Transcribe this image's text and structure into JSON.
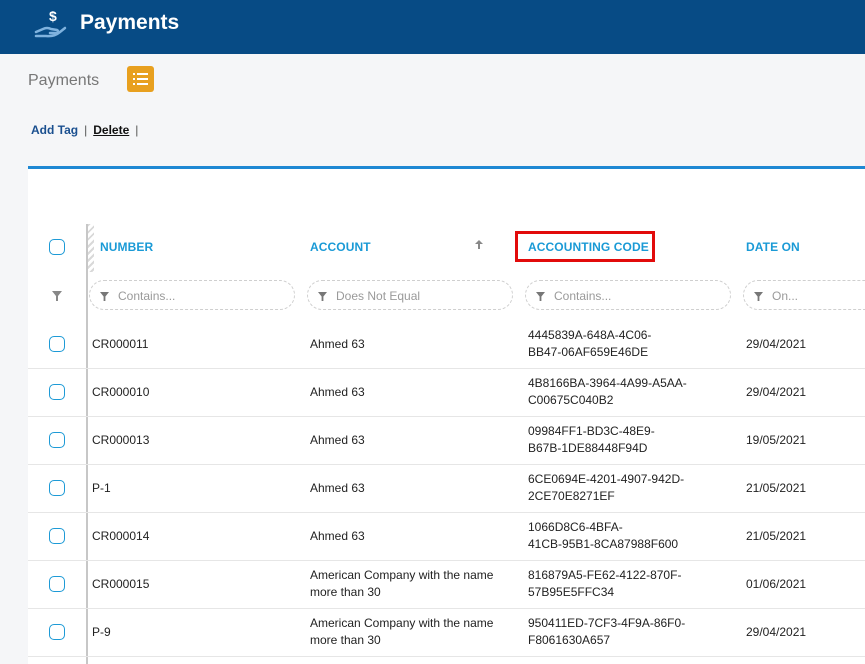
{
  "header": {
    "title": "Payments",
    "icon": "hand-dollar-icon"
  },
  "subbar": {
    "title": "Payments",
    "view_icon": "list-icon",
    "accent": "#e8a01f"
  },
  "actions": {
    "add_tag": "Add Tag",
    "delete": "Delete",
    "separator": "|"
  },
  "table": {
    "columns": [
      "NUMBER",
      "ACCOUNT",
      "ACCOUNTING CODE",
      "DATE ON"
    ],
    "filters": [
      "Contains...",
      "Does Not Equal",
      "Contains...",
      "On..."
    ],
    "rows": [
      {
        "number": "CR000011",
        "account": [
          "Ahmed 63"
        ],
        "code": [
          "4445839A-648A-4C06-",
          "BB47-06AF659E46DE"
        ],
        "date": "29/04/2021"
      },
      {
        "number": "CR000010",
        "account": [
          "Ahmed 63"
        ],
        "code": [
          "4B8166BA-3964-4A99-A5AA-",
          "C00675C040B2"
        ],
        "date": "29/04/2021"
      },
      {
        "number": "CR000013",
        "account": [
          "Ahmed 63"
        ],
        "code": [
          "09984FF1-BD3C-48E9-",
          "B67B-1DE88448F94D"
        ],
        "date": "19/05/2021"
      },
      {
        "number": "P-1",
        "account": [
          "Ahmed 63"
        ],
        "code": [
          "6CE0694E-4201-4907-942D-",
          "2CE70E8271EF"
        ],
        "date": "21/05/2021"
      },
      {
        "number": "CR000014",
        "account": [
          "Ahmed 63"
        ],
        "code": [
          "1066D8C6-4BFA-",
          "41CB-95B1-8CA87988F600"
        ],
        "date": "21/05/2021"
      },
      {
        "number": "CR000015",
        "account": [
          "American Company with the name",
          "more than 30"
        ],
        "code": [
          "816879A5-FE62-4122-870F-",
          "57B95E5FFC34"
        ],
        "date": "01/06/2021"
      },
      {
        "number": "P-9",
        "account": [
          "American Company with the name",
          "more than 30"
        ],
        "code": [
          "950411ED-7CF3-4F9A-86F0-",
          "F8061630A657"
        ],
        "date": "29/04/2021"
      }
    ]
  },
  "colors": {
    "header_bg": "#074b85",
    "link": "#1a9ad6",
    "highlight": "#e20b0b",
    "panel_accent": "#1e88d3"
  }
}
